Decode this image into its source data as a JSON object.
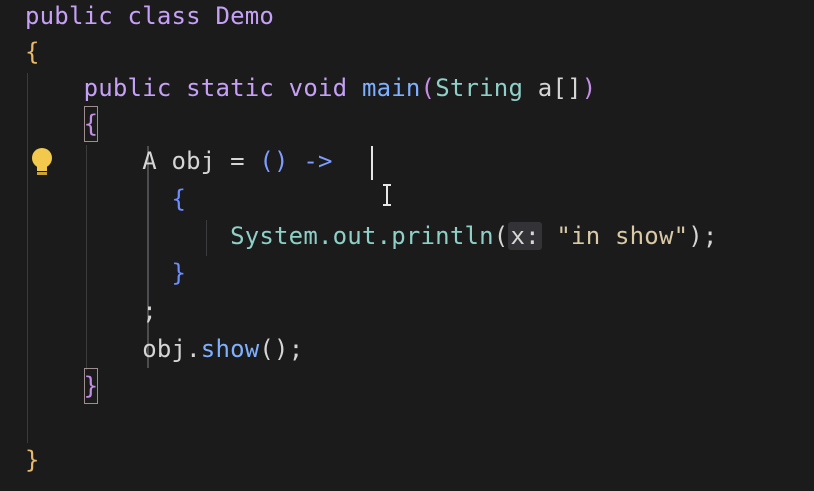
{
  "editor": {
    "lines": [
      {
        "id": "line-1",
        "tokens": [
          {
            "t": "public class ",
            "c": "kw"
          },
          {
            "t": "Demo",
            "c": "kw"
          }
        ]
      },
      {
        "id": "line-2",
        "tokens": [
          {
            "t": "{",
            "c": "brace1"
          }
        ]
      },
      {
        "id": "line-3",
        "tokens": [
          {
            "t": "    public static void ",
            "c": "kw"
          },
          {
            "t": "main",
            "c": "fn"
          },
          {
            "t": "(",
            "c": "brace2"
          },
          {
            "t": "String",
            "c": "ty"
          },
          {
            "t": " a",
            "c": "plain"
          },
          {
            "t": "[]",
            "c": "plain"
          },
          {
            "t": ")",
            "c": "brace2"
          }
        ]
      },
      {
        "id": "line-4",
        "tokens": [
          {
            "t": "    ",
            "c": "plain"
          },
          {
            "t": "{",
            "c": "brace2",
            "box": true
          }
        ]
      },
      {
        "id": "line-5",
        "tokens": [
          {
            "t": "        A obj ",
            "c": "plain"
          },
          {
            "t": "= ",
            "c": "plain"
          },
          {
            "t": "()",
            "c": "op"
          },
          {
            "t": " ->",
            "c": "op"
          }
        ]
      },
      {
        "id": "line-6",
        "tokens": [
          {
            "t": "          ",
            "c": "plain"
          },
          {
            "t": "{",
            "c": "brace3"
          }
        ]
      },
      {
        "id": "line-7",
        "tokens": [
          {
            "t": "              System.out.",
            "c": "ty"
          },
          {
            "t": "println",
            "c": "ty"
          },
          {
            "t": "(",
            "c": "plain"
          },
          {
            "t": "x:",
            "c": "hint"
          },
          {
            "t": " \"in show\"",
            "c": "str"
          },
          {
            "t": ");",
            "c": "plain"
          }
        ]
      },
      {
        "id": "line-8",
        "tokens": [
          {
            "t": "          ",
            "c": "plain"
          },
          {
            "t": "}",
            "c": "brace3"
          }
        ]
      },
      {
        "id": "line-9",
        "tokens": [
          {
            "t": "        ;",
            "c": "plain"
          }
        ]
      },
      {
        "id": "line-10",
        "tokens": [
          {
            "t": "        obj.",
            "c": "plain"
          },
          {
            "t": "show",
            "c": "fn"
          },
          {
            "t": "()",
            "c": "plain"
          },
          {
            "t": ";",
            "c": "plain"
          }
        ]
      },
      {
        "id": "line-11",
        "tokens": [
          {
            "t": "    ",
            "c": "plain"
          },
          {
            "t": "}",
            "c": "brace2",
            "box": true
          }
        ]
      },
      {
        "id": "line-12",
        "tokens": []
      },
      {
        "id": "line-13",
        "tokens": [
          {
            "t": "}",
            "c": "brace1"
          }
        ]
      }
    ],
    "colors": {
      "background": "#1b1b1c",
      "keyword": "#c6a0f6",
      "type": "#8ed0c7",
      "string": "#d9c9a5",
      "bulb": "#f2c94c"
    },
    "icons": {
      "bulb": "lightbulb-icon",
      "ibeam": "text-cursor-icon"
    }
  }
}
